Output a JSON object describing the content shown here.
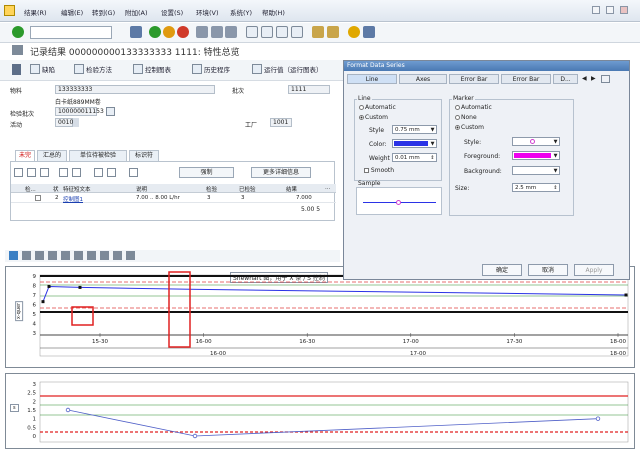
{
  "menu": {
    "items": [
      "结果(R)",
      "编辑(E)",
      "转到(G)",
      "附加(A)",
      "设置(S)",
      "环境(V)",
      "系统(Y)",
      "帮助(H)"
    ]
  },
  "title": {
    "text": "记录结果 000000000133333333 1111: 特性总览"
  },
  "app_toolbar": {
    "items": [
      "缺陷",
      "检验方法",
      "控制图表",
      "历史程序",
      "运行值（运行图表）"
    ]
  },
  "header": {
    "material_label": "物料",
    "material_value": "133333333",
    "material_desc": "白卡纸889MM卷",
    "batch_label": "批次",
    "batch_value": "1111",
    "lot_label": "检验批次",
    "lot_value": "100000011153",
    "activity_label": "活动",
    "activity_value": "0010",
    "plant_label": "工厂",
    "plant_value": "1001"
  },
  "tabs": [
    "未完",
    "汇总的",
    "单位待被检验",
    "标识符"
  ],
  "grid": {
    "toolbar_buttons": [
      "强制",
      "更多详细信息"
    ],
    "columns": [
      "检...",
      "状",
      "特征短文本",
      "说明",
      "检验",
      "已检验",
      "结果",
      "..."
    ],
    "rows": [
      {
        "no": "2",
        "name": "控制图1",
        "desc": "7.00 .. 8.00 L/hr",
        "n1": "3",
        "n2": "3",
        "result": "7.000"
      }
    ],
    "subvalue": "5.00 5"
  },
  "chart_top": {
    "title": "Shewhart 图，用于 X 条 / S 控制",
    "ylabel": "x-quer",
    "y_ticks": [
      "9",
      "8",
      "7",
      "6",
      "5",
      "4",
      "3"
    ],
    "x_ticks_1": [
      "15-30",
      "16-00",
      "16-30",
      "17-00",
      "17-30",
      "18-00"
    ],
    "x_ticks_2": [
      "16-00",
      "17-00",
      "18-00"
    ]
  },
  "chart_bottom": {
    "ylabel": "s",
    "y_ticks": [
      "3",
      "2.5",
      "2",
      "1.5",
      "1",
      "0.5",
      "0"
    ]
  },
  "chart_data": [
    {
      "type": "line",
      "title": "Shewhart 图，用于 X 条 / S 控制",
      "ylabel": "x-quer",
      "ylim": [
        3,
        9
      ],
      "series": [
        {
          "values": [
            6.3,
            7.9,
            7.8,
            7.6,
            7.4,
            7.2,
            7.0
          ]
        }
      ]
    },
    {
      "type": "line",
      "ylabel": "s",
      "ylim": [
        0,
        3
      ],
      "series": [
        {
          "values": [
            1.5,
            0.0,
            1.0
          ]
        }
      ]
    }
  ],
  "dialog": {
    "title": "Format Data Series",
    "tabs": [
      "Line",
      "Axes",
      "Error Bar",
      "Error Bar",
      "D..."
    ],
    "line_group": "Line",
    "automatic": "Automatic",
    "custom": "Custom",
    "style_label": "Style",
    "style_value": "0.75 mm",
    "color_label": "Color:",
    "weight_label": "Weight",
    "weight_value": "0.01 mm",
    "smooth_label": "Smooth",
    "sample_label": "Sample",
    "marker_group": "Marker",
    "m_automatic": "Automatic",
    "m_none": "None",
    "m_custom": "Custom",
    "m_style_label": "Style:",
    "m_fg_label": "Foreground:",
    "m_bg_label": "Background:",
    "size_label": "Size:",
    "size_value": "2.5 mm",
    "ok": "确定",
    "cancel": "取消",
    "apply": "Apply",
    "colors": {
      "line": "#2b33e6",
      "foreground": "#ee00ee"
    }
  }
}
